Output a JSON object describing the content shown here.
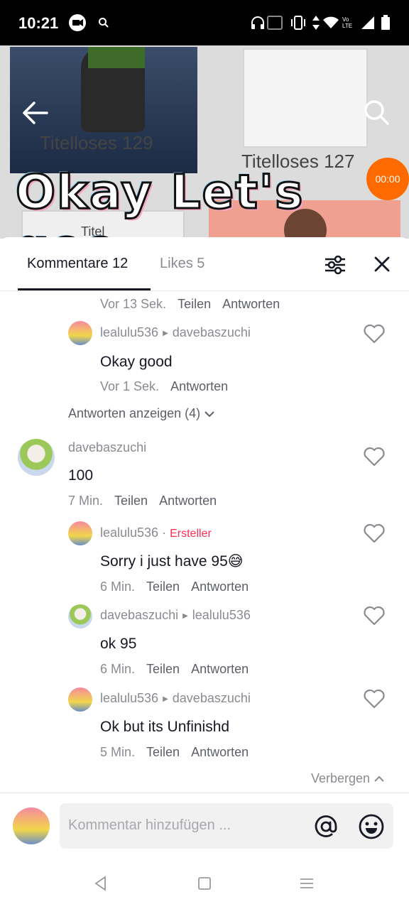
{
  "status_bar": {
    "time": "10:21",
    "icons": [
      "video-record-icon",
      "search-icon",
      "headphones-icon",
      "nfc-icon",
      "vibrate-icon",
      "data-arrows-icon",
      "wifi-icon",
      "volte-icon",
      "signal-icon",
      "battery-icon"
    ],
    "volte_label": "Vo LTE"
  },
  "video": {
    "thumb_labels": [
      "Titelloses 129",
      "Titelloses 127",
      "Titel"
    ],
    "overlay_caption": "Okay Let's goo",
    "timer_badge": "00:00"
  },
  "sheet": {
    "tabs": [
      {
        "label": "Kommentare 12",
        "active": true
      },
      {
        "label": "Likes 5",
        "active": false
      }
    ],
    "comments": [
      {
        "meta": [
          "Vor 13 Sek.",
          "Teilen",
          "Antworten"
        ]
      },
      {
        "user": "lealulu536",
        "reply_to": "davebaszuchi",
        "text": "Okay good",
        "meta": [
          "Vor 1 Sek.",
          "Antworten"
        ]
      },
      {
        "user": "davebaszuchi",
        "text": "100",
        "meta": [
          "7 Min.",
          "Teilen",
          "Antworten"
        ]
      },
      {
        "user": "lealulu536",
        "badge": "Ersteller",
        "text": "Sorry i just have 95😅",
        "meta": [
          "6 Min.",
          "Teilen",
          "Antworten"
        ]
      },
      {
        "user": "davebaszuchi",
        "reply_to": "lealulu536",
        "text": "ok 95",
        "meta": [
          "6 Min.",
          "Teilen",
          "Antworten"
        ]
      },
      {
        "user": "lealulu536",
        "reply_to": "davebaszuchi",
        "text": "Ok but its Unfinishd",
        "meta": [
          "5 Min.",
          "Teilen",
          "Antworten"
        ]
      }
    ],
    "show_replies": "Antworten anzeigen (4)",
    "hide_replies": "Verbergen",
    "separator": "·"
  },
  "composer": {
    "placeholder": "Kommentar hinzufügen ..."
  },
  "colors": {
    "accent": "#fe2c55",
    "badge_orange": "#ff6a00",
    "muted_text": "#8a8b91"
  }
}
